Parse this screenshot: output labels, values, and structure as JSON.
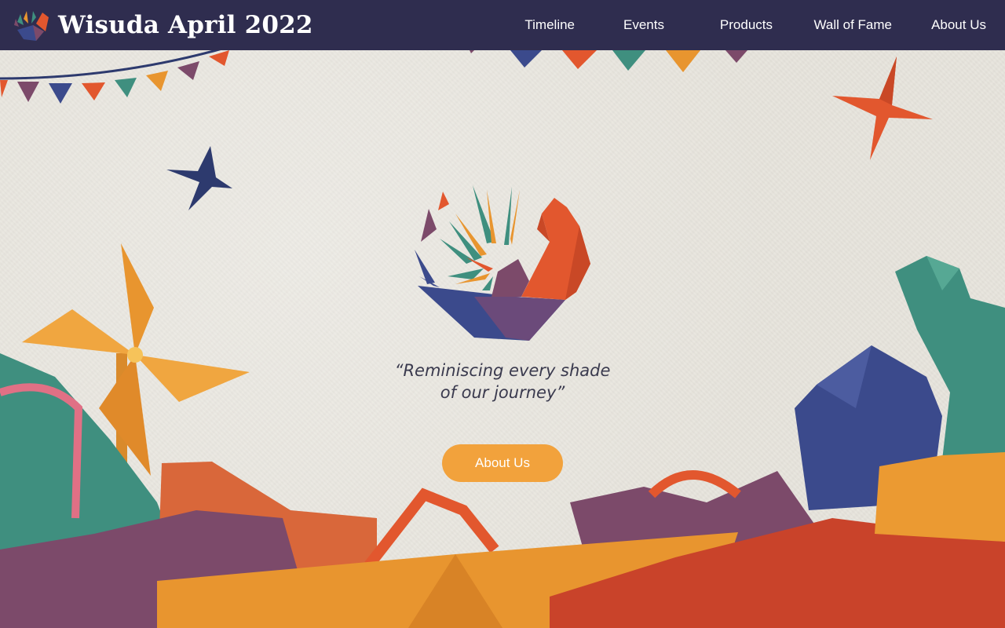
{
  "header": {
    "title": "Wisuda April 2022",
    "logo_icon": "origami-crane-logo-icon",
    "nav": [
      {
        "label": "Timeline"
      },
      {
        "label": "Events"
      },
      {
        "label": "Products"
      },
      {
        "label": "Wall of Fame"
      },
      {
        "label": "About Us"
      }
    ]
  },
  "hero": {
    "logo_icon": "origami-crane-logo-icon",
    "tagline_line1": "“Reminiscing every shade",
    "tagline_line2": "of our journey”",
    "cta_label": "About Us"
  },
  "colors": {
    "navbar": "#2f2d4f",
    "paper": "#e8e5dd",
    "cta": "#f2a23c",
    "orange": "#e2572e",
    "teal": "#3f8f7f",
    "navy": "#3b4a8c",
    "plum": "#7c4a6a",
    "yellow": "#e8952f"
  }
}
